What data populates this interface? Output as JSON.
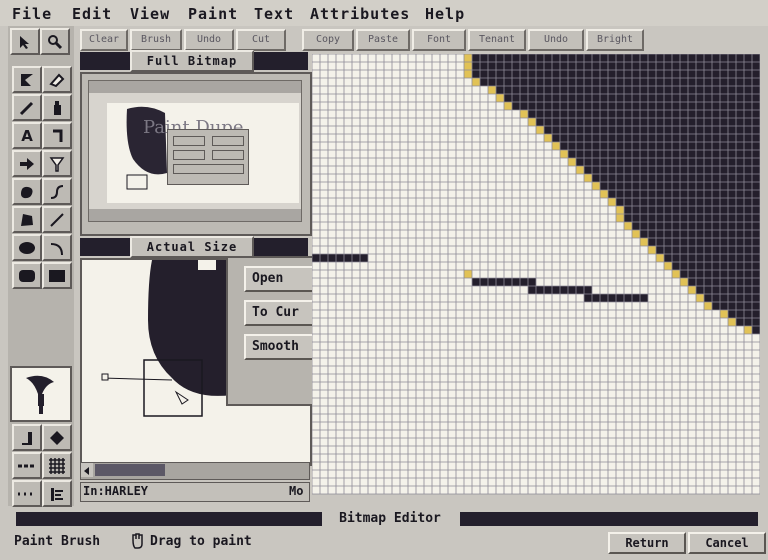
{
  "menu": [
    "File",
    "Edit",
    "View",
    "Paint",
    "Text",
    "Attributes",
    "Help"
  ],
  "toolbar": [
    "Clear",
    "Brush",
    "Undo",
    "Cut",
    "Copy",
    "Paste",
    "Font",
    "Tenant",
    "Undo",
    "Bright"
  ],
  "panels": {
    "full_bitmap_title": "Full Bitmap",
    "actual_size_title": "Actual Size",
    "preview_caption": "Paint Dupe"
  },
  "popup_menu": {
    "open": "Open",
    "to_cursor": "To Cur",
    "smooth": "Smooth"
  },
  "filename": "In:HARLEY",
  "filename_suffix": "Mo",
  "status": {
    "title": "Bitmap Editor",
    "tool": "Paint Brush",
    "hint": "Drag to paint",
    "return_label": "Return",
    "cancel_label": "Cancel"
  },
  "colors": {
    "ink": "#241f2c",
    "paper": "#f4f2ea",
    "grid": "#8d8a96",
    "edge": "#e1c256",
    "chrome": "#c9c6c0"
  },
  "tools": [
    "select-arrow-icon",
    "magnifier-icon",
    "lasso-icon",
    "eraser-icon",
    "pencil-icon",
    "spray-can-icon",
    "text-icon",
    "paint-bucket-icon",
    "arrow-right-icon",
    "lightbulb-icon",
    "filled-blob-icon",
    "curve-icon",
    "filled-polygon-icon",
    "line-icon",
    "filled-ellipse-icon",
    "arc-icon",
    "rounded-rect-icon",
    "filled-rect-icon"
  ]
}
